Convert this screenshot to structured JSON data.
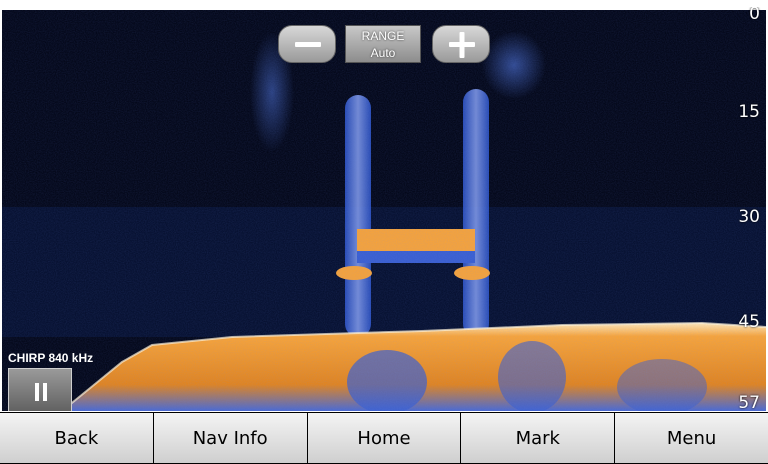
{
  "range": {
    "title": "RANGE",
    "value": "Auto"
  },
  "depth_scale": [
    "0",
    "15",
    "30",
    "45",
    "57"
  ],
  "sonar": {
    "frequency_label": "CHIRP 840 kHz"
  },
  "icons": {
    "minus": "minus-icon",
    "plus": "plus-icon",
    "pause": "pause-icon"
  },
  "nav": {
    "buttons": [
      {
        "label": "Back"
      },
      {
        "label": "Nav Info"
      },
      {
        "label": "Home"
      },
      {
        "label": "Mark"
      },
      {
        "label": "Menu"
      }
    ]
  },
  "colors": {
    "background": "#05091c",
    "return_strong": "#f59a2a",
    "return_weak": "#2f5fc8",
    "bottom_bar": "#e6e6e6"
  }
}
